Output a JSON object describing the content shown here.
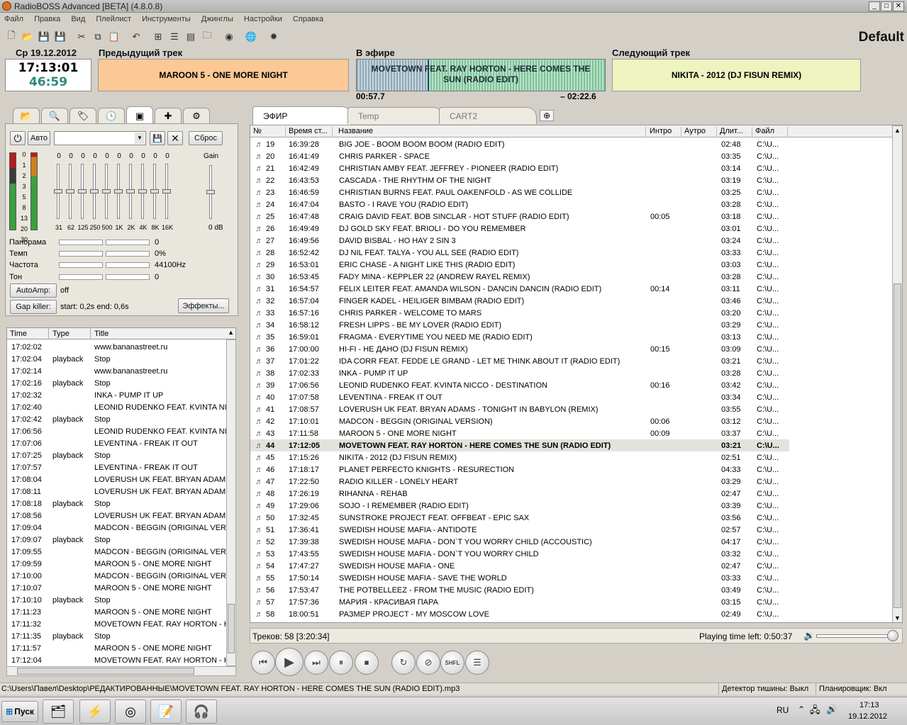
{
  "window": {
    "title": "RadioBOSS Advanced [BETA] (4.8.0.8)",
    "btn_min": "_",
    "btn_max": "□",
    "btn_close": "✕"
  },
  "menu": [
    "Файл",
    "Правка",
    "Вид",
    "Плейлист",
    "Инструменты",
    "Джинглы",
    "Настройки",
    "Справка"
  ],
  "profile": "Default",
  "clock": {
    "date": "Ср 19.12.2012",
    "time": "17:13:01",
    "remaining": "46:59"
  },
  "prev_track": {
    "label": "Предыдущий трек",
    "title": "MAROON 5 - ONE MORE NIGHT"
  },
  "on_air": {
    "label": "В эфире",
    "title": "MOVETOWN FEAT. RAY HORTON - HERE COMES THE SUN (RADIO EDIT)",
    "elapsed": "00:57.7",
    "remaining": "– 02:22.6"
  },
  "next_track": {
    "label": "Следующий трек",
    "title": "NIKITA - 2012 (DJ FISUN REMIX)"
  },
  "left_tabs": [
    "folder-icon",
    "search-icon",
    "tag-icon",
    "clock-icon",
    "mixer-icon",
    "plugin-icon",
    "gear-icon"
  ],
  "mixer": {
    "auto_label": "Авто",
    "reset_label": "Сброс",
    "meter_scale": [
      "0",
      "1",
      "2",
      "3",
      "5",
      "8",
      "13",
      "20",
      "30"
    ],
    "eq_values": [
      "0",
      "0",
      "0",
      "0",
      "0",
      "0",
      "0",
      "0",
      "0",
      "0"
    ],
    "eq_bands": [
      "31",
      "62",
      "125",
      "250",
      "500",
      "1K",
      "2K",
      "4K",
      "8K",
      "16K"
    ],
    "gain_label": "Gain",
    "gain_value": "0 dB",
    "pan_label": "Панорама",
    "pan_value": "0",
    "tempo_label": "Темп",
    "tempo_value": "0%",
    "freq_label": "Частота",
    "freq_value": "44100Hz",
    "pitch_label": "Тон",
    "pitch_value": "0",
    "autoamp_label": "AutoAmp:",
    "autoamp_value": "off",
    "gapkiller_label": "Gap killer:",
    "gapkiller_value": "start: 0,2s end: 0,6s",
    "effects_label": "Эффекты..."
  },
  "log": {
    "columns": [
      "Time",
      "Type",
      "Title"
    ],
    "rows": [
      [
        "17:02:02",
        "",
        "www.bananastreet.ru"
      ],
      [
        "17:02:04",
        "playback",
        "Stop"
      ],
      [
        "17:02:14",
        "",
        "www.bananastreet.ru"
      ],
      [
        "17:02:16",
        "playback",
        "Stop"
      ],
      [
        "17:02:32",
        "",
        "INKA - PUMP IT UP"
      ],
      [
        "17:02:40",
        "",
        "LEONID RUDENKO FEAT. KVINTA NICC"
      ],
      [
        "17:02:42",
        "playback",
        "Stop"
      ],
      [
        "17:06:56",
        "",
        "LEONID RUDENKO FEAT. KVINTA NICC"
      ],
      [
        "17:07:06",
        "",
        "LEVENTINA - FREAK IT OUT"
      ],
      [
        "17:07:25",
        "playback",
        "Stop"
      ],
      [
        "17:07:57",
        "",
        "LEVENTINA - FREAK IT OUT"
      ],
      [
        "17:08:04",
        "",
        "LOVERUSH UK FEAT. BRYAN ADAMS - T"
      ],
      [
        "17:08:11",
        "",
        "LOVERUSH UK FEAT. BRYAN ADAMS - T"
      ],
      [
        "17:08:18",
        "playback",
        "Stop"
      ],
      [
        "17:08:56",
        "",
        "LOVERUSH UK FEAT. BRYAN ADAMS - T"
      ],
      [
        "17:09:04",
        "",
        "MADCON - BEGGIN (ORIGINAL VERSIC"
      ],
      [
        "17:09:07",
        "playback",
        "Stop"
      ],
      [
        "17:09:55",
        "",
        "MADCON - BEGGIN (ORIGINAL VERSIC"
      ],
      [
        "17:09:59",
        "",
        "MAROON 5 - ONE MORE NIGHT"
      ],
      [
        "17:10:00",
        "",
        "MADCON - BEGGIN (ORIGINAL VERSIC"
      ],
      [
        "17:10:07",
        "",
        "MAROON 5 - ONE MORE NIGHT"
      ],
      [
        "17:10:10",
        "playback",
        "Stop"
      ],
      [
        "17:11:23",
        "",
        "MAROON 5 - ONE MORE NIGHT"
      ],
      [
        "17:11:32",
        "",
        "MOVETOWN FEAT. RAY HORTON - HEF"
      ],
      [
        "17:11:35",
        "playback",
        "Stop"
      ],
      [
        "17:11:57",
        "",
        "MAROON 5 - ONE MORE NIGHT"
      ],
      [
        "17:12:04",
        "",
        "MOVETOWN FEAT. RAY HORTON - HEF"
      ]
    ]
  },
  "playlist_tabs": [
    "ЭФИР",
    "Temp",
    "CART2"
  ],
  "playlist": {
    "columns": [
      "№",
      "Время ст...",
      "Название",
      "Интро",
      "Аутро",
      "Длит...",
      "Файл"
    ],
    "current_index": 25,
    "rows": [
      [
        "19",
        "16:39:28",
        "BIG JOE - BOOM BOOM BOOM (RADIO EDIT)",
        "",
        "",
        "02:48",
        "C:\\U..."
      ],
      [
        "20",
        "16:41:49",
        "CHRIS PARKER - SPACE",
        "",
        "",
        "03:35",
        "C:\\U..."
      ],
      [
        "21",
        "16:42:49",
        "CHRISTIAN AMBY FEAT. JEFFREY - PIONEER (RADIO EDIT)",
        "",
        "",
        "03:14",
        "C:\\U..."
      ],
      [
        "22",
        "16:43:53",
        "CASCADA - THE RHYTHM OF THE NIGHT",
        "",
        "",
        "03:19",
        "C:\\U..."
      ],
      [
        "23",
        "16:46:59",
        "CHRISTIAN BURNS FEAT. PAUL OAKENFOLD - AS WE COLLIDE",
        "",
        "",
        "03:25",
        "C:\\U..."
      ],
      [
        "24",
        "16:47:04",
        "BASTO - I RAVE YOU (RADIO EDIT)",
        "",
        "",
        "03:28",
        "C:\\U..."
      ],
      [
        "25",
        "16:47:48",
        "CRAIG DAVID FEAT. BOB SINCLAR - HOT STUFF (RADIO EDIT)",
        "00:05",
        "",
        "03:18",
        "C:\\U..."
      ],
      [
        "26",
        "16:49:49",
        "DJ GOLD SKY FEAT. BRIOLI - DO YOU REMEMBER",
        "",
        "",
        "03:01",
        "C:\\U..."
      ],
      [
        "27",
        "16:49:56",
        "DAVID BISBAL - HO HAY 2 SIN 3",
        "",
        "",
        "03:24",
        "C:\\U..."
      ],
      [
        "28",
        "16:52:42",
        "DJ NIL FEAT. TALYA - YOU ALL SEE (RADIO EDIT)",
        "",
        "",
        "03:33",
        "C:\\U..."
      ],
      [
        "29",
        "16:53:01",
        "ERIC CHASE - A NIGHT LIKE THIS (RADIO EDIT)",
        "",
        "",
        "03:03",
        "C:\\U..."
      ],
      [
        "30",
        "16:53:45",
        "FADY MINA - KEPPLER 22 (ANDREW RAYEL REMIX)",
        "",
        "",
        "03:28",
        "C:\\U..."
      ],
      [
        "31",
        "16:54:57",
        "FELIX LEITER FEAT. AMANDA WILSON - DANCIN DANCIN (RADIO EDIT)",
        "00:14",
        "",
        "03:11",
        "C:\\U..."
      ],
      [
        "32",
        "16:57:04",
        "FINGER KADEL - HEILIGER BIMBAM (RADIO EDIT)",
        "",
        "",
        "03:46",
        "C:\\U..."
      ],
      [
        "33",
        "16:57:16",
        "CHRIS PARKER - WELCOME TO MARS",
        "",
        "",
        "03:20",
        "C:\\U..."
      ],
      [
        "34",
        "16:58:12",
        "FRESH LIPPS - BE MY LOVER (RADIO EDIT)",
        "",
        "",
        "03:29",
        "C:\\U..."
      ],
      [
        "35",
        "16:59:01",
        "FRAGMA - EVERYTIME YOU NEED ME (RADIO EDIT)",
        "",
        "",
        "03:13",
        "C:\\U..."
      ],
      [
        "36",
        "17:00:00",
        "HI-FI - НЕ ДАНО (DJ FISUN REMIX)",
        "00:15",
        "",
        "03:09",
        "C:\\U..."
      ],
      [
        "37",
        "17:01:22",
        "IDA CORR FEAT. FEDDE LE GRAND - LET ME THINK ABOUT IT (RADIO EDIT)",
        "",
        "",
        "03:21",
        "C:\\U..."
      ],
      [
        "38",
        "17:02:33",
        "INKA - PUMP IT UP",
        "",
        "",
        "03:28",
        "C:\\U..."
      ],
      [
        "39",
        "17:06:56",
        "LEONID RUDENKO FEAT. KVINTA NICCO - DESTINATION",
        "00:16",
        "",
        "03:42",
        "C:\\U..."
      ],
      [
        "40",
        "17:07:58",
        "LEVENTINA - FREAK IT OUT",
        "",
        "",
        "03:34",
        "C:\\U..."
      ],
      [
        "41",
        "17:08:57",
        "LOVERUSH UK FEAT. BRYAN ADAMS - TONIGHT IN BABYLON (REMIX)",
        "",
        "",
        "03:55",
        "C:\\U..."
      ],
      [
        "42",
        "17:10:01",
        "MADCON - BEGGIN (ORIGINAL VERSION)",
        "00:06",
        "",
        "03:12",
        "C:\\U..."
      ],
      [
        "43",
        "17:11:58",
        "MAROON 5 - ONE MORE NIGHT",
        "00:09",
        "",
        "03:37",
        "C:\\U..."
      ],
      [
        "44",
        "17:12:05",
        "MOVETOWN FEAT. RAY HORTON - HERE COMES THE SUN (RADIO EDIT)",
        "",
        "",
        "03:21",
        "C:\\U..."
      ],
      [
        "45",
        "17:15:26",
        "NIKITA - 2012 (DJ FISUN REMIX)",
        "",
        "",
        "02:51",
        "C:\\U..."
      ],
      [
        "46",
        "17:18:17",
        "PLANET PERFECTO KNIGHTS - RESURECTION",
        "",
        "",
        "04:33",
        "C:\\U..."
      ],
      [
        "47",
        "17:22:50",
        "RADIO KILLER - LONELY HEART",
        "",
        "",
        "03:29",
        "C:\\U..."
      ],
      [
        "48",
        "17:26:19",
        "RIHANNA - REHAB",
        "",
        "",
        "02:47",
        "C:\\U..."
      ],
      [
        "49",
        "17:29:06",
        "SOJO - I REMEMBER (RADIO EDIT)",
        "",
        "",
        "03:39",
        "C:\\U..."
      ],
      [
        "50",
        "17:32:45",
        "SUNSTROKE PROJECT FEAT. OFFBEAT - EPIC SAX",
        "",
        "",
        "03:56",
        "C:\\U..."
      ],
      [
        "51",
        "17:36:41",
        "SWEDISH HOUSE MAFIA - ANTIDOTE",
        "",
        "",
        "02:57",
        "C:\\U..."
      ],
      [
        "52",
        "17:39:38",
        "SWEDISH HOUSE MAFIA - DON`T YOU WORRY CHILD (ACCOUSTIC)",
        "",
        "",
        "04:17",
        "C:\\U..."
      ],
      [
        "53",
        "17:43:55",
        "SWEDISH HOUSE MAFIA - DON`T YOU WORRY CHILD",
        "",
        "",
        "03:32",
        "C:\\U..."
      ],
      [
        "54",
        "17:47:27",
        "SWEDISH HOUSE MAFIA - ONE",
        "",
        "",
        "02:47",
        "C:\\U..."
      ],
      [
        "55",
        "17:50:14",
        "SWEDISH HOUSE MAFIA - SAVE THE WORLD",
        "",
        "",
        "03:33",
        "C:\\U..."
      ],
      [
        "56",
        "17:53:47",
        "THE POTBELLEEZ - FROM THE MUSIC (RADIO EDIT)",
        "",
        "",
        "03:49",
        "C:\\U..."
      ],
      [
        "57",
        "17:57:36",
        "МАРИЯ - КРАСИВАЯ ПАРА",
        "",
        "",
        "03:15",
        "C:\\U..."
      ],
      [
        "58",
        "18:00:51",
        "РАЗМЕР PROJECT - MY MOSCOW LOVE",
        "",
        "",
        "02:49",
        "C:\\U..."
      ]
    ]
  },
  "playlist_status": {
    "tracks": "Треков: 58 [3:20:34]",
    "time_left": "Playing time left: 0:50:37"
  },
  "player_buttons": [
    "prev",
    "play",
    "next",
    "pause",
    "stop",
    "loop",
    "disable",
    "SHFL",
    "list"
  ],
  "statusbar": {
    "filepath": "C:\\Users\\Павел\\Desktop\\РЕДАКТИРОВАННЫЕ\\MOVETOWN FEAT. RAY HORTON - HERE COMES THE SUN (RADIO EDIT).mp3",
    "silence_detector": "Детектор тишины: Выкл",
    "scheduler": "Планировщик: Вкл"
  },
  "taskbar": {
    "start": "Пуск",
    "lang": "RU",
    "time": "17:13",
    "date": "19.12.2012"
  },
  "colors": {
    "prev_bg": "#fbc896",
    "next_bg": "#eef4c0",
    "clock_green": "#2e8a7a"
  }
}
